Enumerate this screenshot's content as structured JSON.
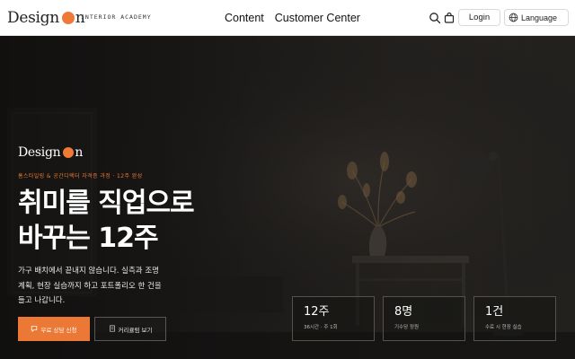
{
  "header": {
    "brand": {
      "name_pre": "Design",
      "name_post": "n",
      "tagline": "INTERIOR ACADEMY"
    },
    "nav": [
      {
        "label": "Content"
      },
      {
        "label": "Customer Center"
      }
    ],
    "icons": {
      "search": "search-icon",
      "cart": "shopping-bag-icon",
      "globe": "globe-icon"
    },
    "login_label": "Login",
    "language_label": "Language"
  },
  "hero": {
    "brand": {
      "name_pre": "Design",
      "name_post": "n"
    },
    "eyebrow": "홈스타일링 & 공간디렉터 자격증 과정 · 12주 완성",
    "headline_line1": "취미를 직업으로",
    "headline_line2": "바꾸는 12주",
    "desc_line1": "가구 배치에서 끝내지 않습니다. 실측과 조명",
    "desc_line2": "계획, 현장 실습까지 하고 포트폴리오 한 건을",
    "desc_line3": "들고 나갑니다.",
    "cta_primary": "무료 상담 신청",
    "cta_secondary": "커리큘럼 보기",
    "stats": [
      {
        "value": "12주",
        "caption": "36시간 · 주 1회"
      },
      {
        "value": "8명",
        "caption": "기수당 정원"
      },
      {
        "value": "1건",
        "caption": "수료 시 현장 실습"
      }
    ]
  },
  "colors": {
    "accent": "#ec7836",
    "header_bg": "#ffffff",
    "hero_bg": "#1f1d1b"
  }
}
